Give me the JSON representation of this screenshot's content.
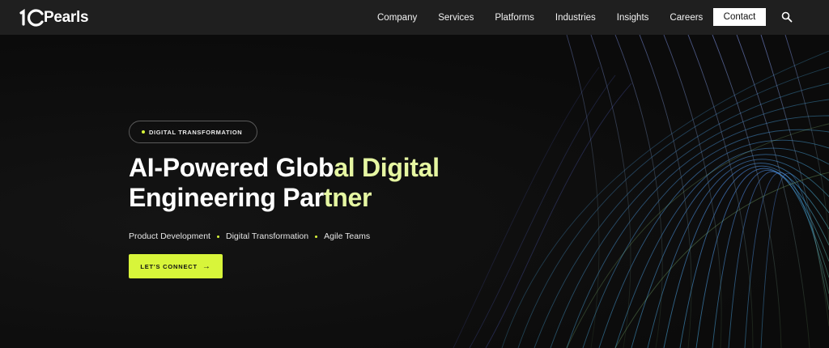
{
  "brand": {
    "logo_text": "Pearls",
    "accent_color": "#d8f53a"
  },
  "nav": {
    "items": [
      "Company",
      "Services",
      "Platforms",
      "Industries",
      "Insights",
      "Careers"
    ],
    "contact_label": "Contact",
    "search_icon": "search-icon"
  },
  "hero": {
    "badge": "DIGITAL TRANSFORMATION",
    "headline_line1_main": "AI-Powered Glob",
    "headline_line1_accent": "al Digital",
    "headline_line2_main": "Engineering Par",
    "headline_line2_accent": "tner",
    "features": [
      "Product Development",
      "Digital Transformation",
      "Agile Teams"
    ],
    "cta_label": "LET'S CONNECT",
    "cta_icon": "arrow-right-icon"
  }
}
